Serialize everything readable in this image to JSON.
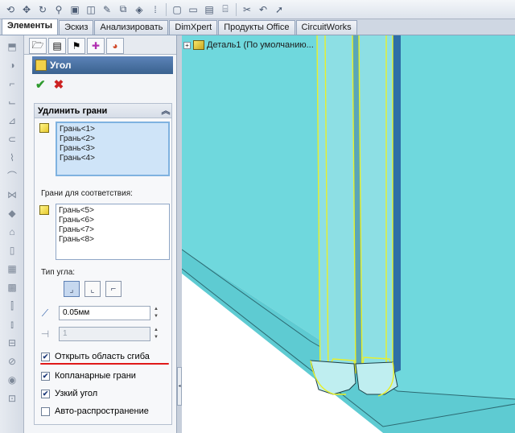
{
  "toolbar": {
    "icons": [
      "new-icon",
      "move-icon",
      "rotate-icon",
      "mate-icon",
      "window-icon",
      "view-icon",
      "sketch-icon",
      "feature-icon",
      "points-icon",
      "sep",
      "select-icon",
      "sheet-icon",
      "cylinder-icon",
      "sep",
      "cut-icon",
      "undo-icon",
      "arrow-icon"
    ]
  },
  "tabs": [
    {
      "label": "Элементы",
      "active": true
    },
    {
      "label": "Эскиз",
      "active": false
    },
    {
      "label": "Анализировать",
      "active": false
    },
    {
      "label": "DimXpert",
      "active": false
    },
    {
      "label": "Продукты Office",
      "active": false
    },
    {
      "label": "CircuitWorks",
      "active": false
    }
  ],
  "property_manager": {
    "title": "Угол",
    "ok_glyph": "✔",
    "cancel_glyph": "✖",
    "group_title": "Удлинить грани",
    "collapse_glyph": "︽",
    "faces_to_extend": [
      "Грань<1>",
      "Грань<2>",
      "Грань<3>",
      "Грань<4>"
    ],
    "match_label": "Грани для соответствия:",
    "faces_to_match": [
      "Грань<5>",
      "Грань<6>",
      "Грань<7>",
      "Грань<8>"
    ],
    "corner_type_label": "Тип угла:",
    "gap_value": "0.05мм",
    "overlap_value": "1",
    "checkboxes": [
      {
        "label": "Открыть область сгиба",
        "checked": true
      },
      {
        "label": "Копланарные грани",
        "checked": true
      },
      {
        "label": "Узкий угол",
        "checked": true
      },
      {
        "label": "Авто-распространение",
        "checked": false
      }
    ]
  },
  "feature_tree": {
    "item_label": "Деталь1  (По умолчанию..."
  },
  "colors": {
    "model_fill": "#6ed7dc",
    "model_dark": "#2f6fa6",
    "edge_highlight": "#e8f02a",
    "annotation_red": "#e01818"
  }
}
